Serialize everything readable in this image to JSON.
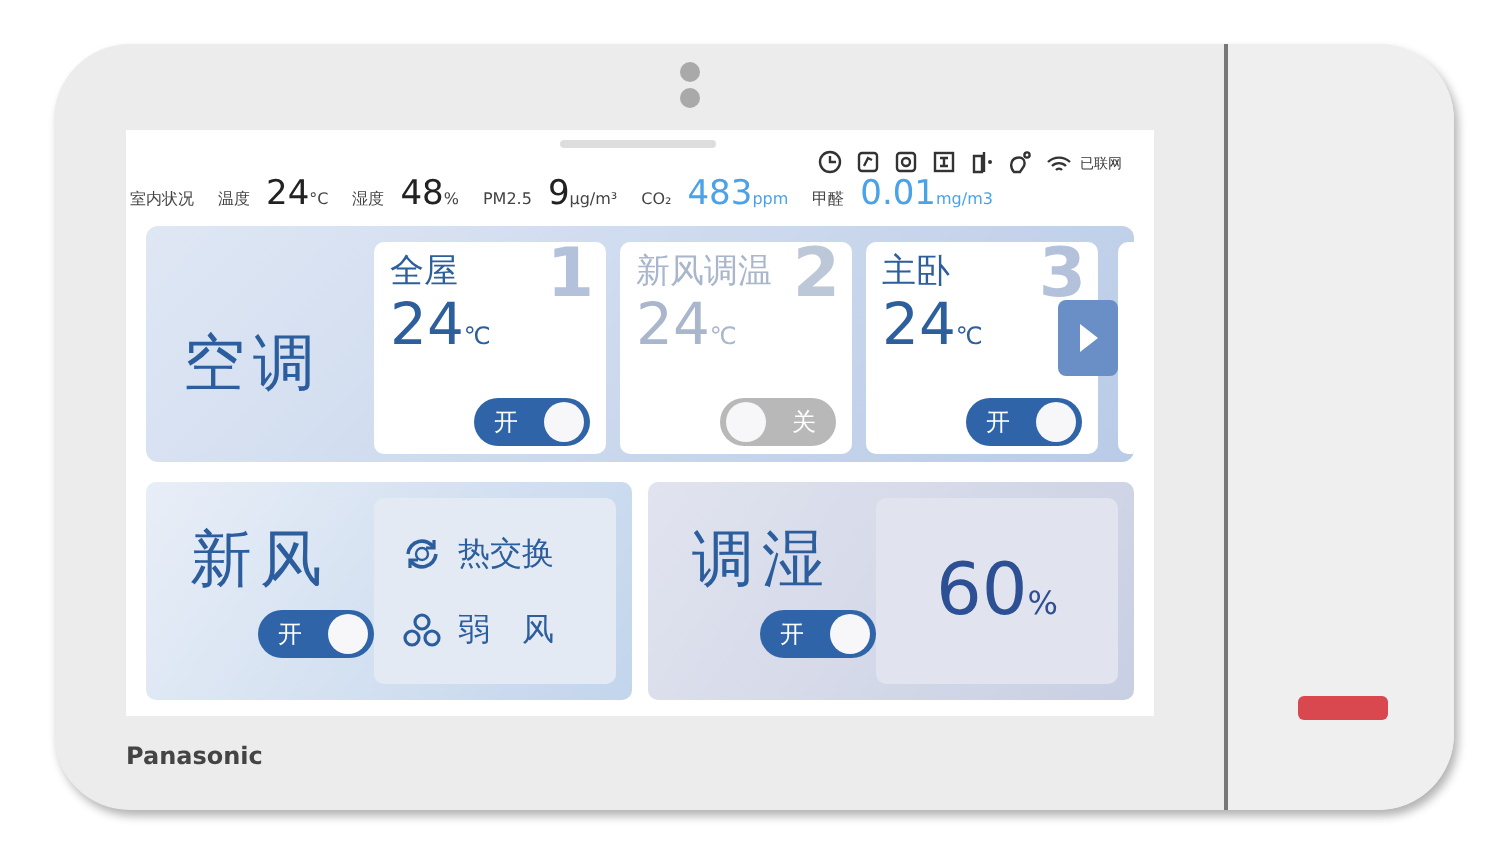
{
  "status_bar": {
    "network_label": "已联网"
  },
  "indoor": {
    "title": "室内状况",
    "readings": [
      {
        "label": "温度",
        "value": "24",
        "unit": "°C",
        "color": "#222222"
      },
      {
        "label": "湿度",
        "value": "48",
        "unit": "%",
        "color": "#222222"
      },
      {
        "label": "PM2.5",
        "value": "9",
        "unit": "μg/m³",
        "color": "#222222"
      },
      {
        "label": "CO₂",
        "value": "483",
        "unit": "ppm",
        "color": "#4aa3e8"
      },
      {
        "label": "甲醛",
        "value": "0.01",
        "unit": "mg/m3",
        "color": "#4aa3e8"
      }
    ]
  },
  "air_conditioner": {
    "title": "空调",
    "zones": [
      {
        "name": "全屋",
        "number": "1",
        "temperature": "24",
        "unit": "℃",
        "on": true,
        "switch_label": "开"
      },
      {
        "name": "新风调温",
        "number": "2",
        "temperature": "24",
        "unit": "℃",
        "on": false,
        "switch_label": "关"
      },
      {
        "name": "主卧",
        "number": "3",
        "temperature": "24",
        "unit": "℃",
        "on": true,
        "switch_label": "开"
      }
    ]
  },
  "fresh_air": {
    "title": "新风",
    "on": true,
    "switch_label": "开",
    "mode": "热交换",
    "fan_speed": "弱　风"
  },
  "humidity": {
    "title": "调湿",
    "on": true,
    "switch_label": "开",
    "value": "60",
    "unit": "%"
  },
  "device": {
    "brand": "Panasonic"
  }
}
